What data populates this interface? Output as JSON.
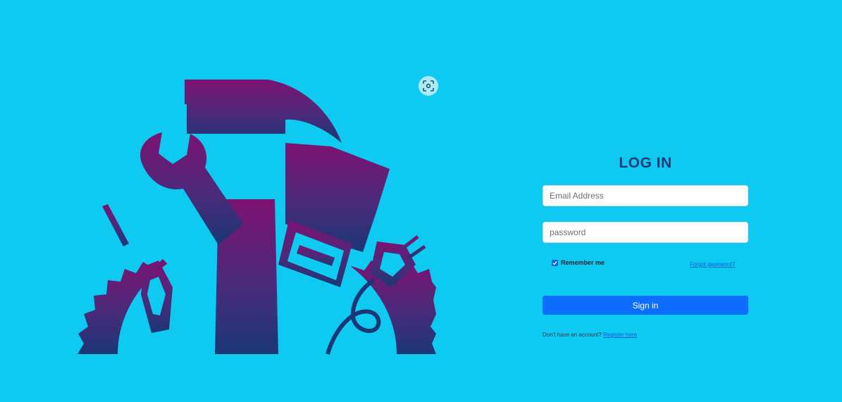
{
  "login": {
    "title": "LOG IN",
    "email_placeholder": "Email Address",
    "password_placeholder": "password",
    "remember_label": "Remember me",
    "remember_checked": true,
    "forgot_label": "Forgot password?",
    "signin_label": "Sign in",
    "register_prompt": "Don't have an account?",
    "register_link": "Register here"
  },
  "icons": {
    "logo": "tools-gear-logo",
    "scan": "screen-scan-icon",
    "checkbox": "checkmark-icon"
  },
  "colors": {
    "background": "#0ec9f0",
    "title": "#1b3c77",
    "button": "#0d6efd",
    "link": "#0a5fd6",
    "logo_top": "#7d1272",
    "logo_bottom": "#1a3775"
  }
}
